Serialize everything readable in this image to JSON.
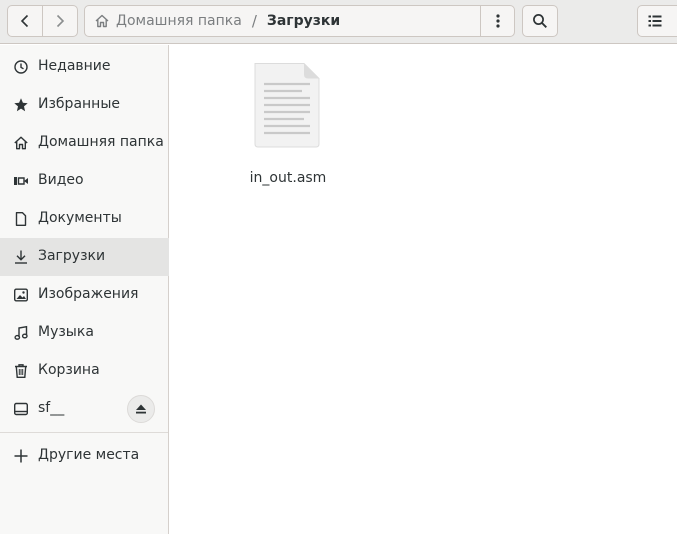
{
  "header": {
    "back_icon": "chevron-left-icon",
    "forward_icon": "chevron-right-icon",
    "path": {
      "home_icon": "home-icon",
      "home_label": "Домашняя папка",
      "separator": "/",
      "current": "Загрузки",
      "menu_icon": "vertical-dots-icon"
    },
    "search_icon": "search-icon",
    "view_icon": "list-view-icon"
  },
  "sidebar": {
    "items": [
      {
        "label": "Недавние",
        "icon": "clock-icon"
      },
      {
        "label": "Избранные",
        "icon": "star-icon"
      },
      {
        "label": "Домашняя папка",
        "icon": "home-icon"
      },
      {
        "label": "Видео",
        "icon": "video-icon"
      },
      {
        "label": "Документы",
        "icon": "document-icon"
      },
      {
        "label": "Загрузки",
        "icon": "download-icon",
        "active": true
      },
      {
        "label": "Изображения",
        "icon": "image-icon"
      },
      {
        "label": "Музыка",
        "icon": "music-icon"
      },
      {
        "label": "Корзина",
        "icon": "trash-icon"
      },
      {
        "label": "sf__",
        "icon": "drive-icon",
        "eject_icon": "eject-icon"
      }
    ],
    "other_places": {
      "label": "Другие места",
      "icon": "plus-icon"
    }
  },
  "files": [
    {
      "name": "in_out.asm",
      "icon": "text-file-icon"
    }
  ],
  "colors": {
    "header_bg": "#ebebea",
    "sidebar_bg": "#f8f8f7",
    "active_item_bg": "#e4e4e3",
    "text": "#2e3436"
  }
}
